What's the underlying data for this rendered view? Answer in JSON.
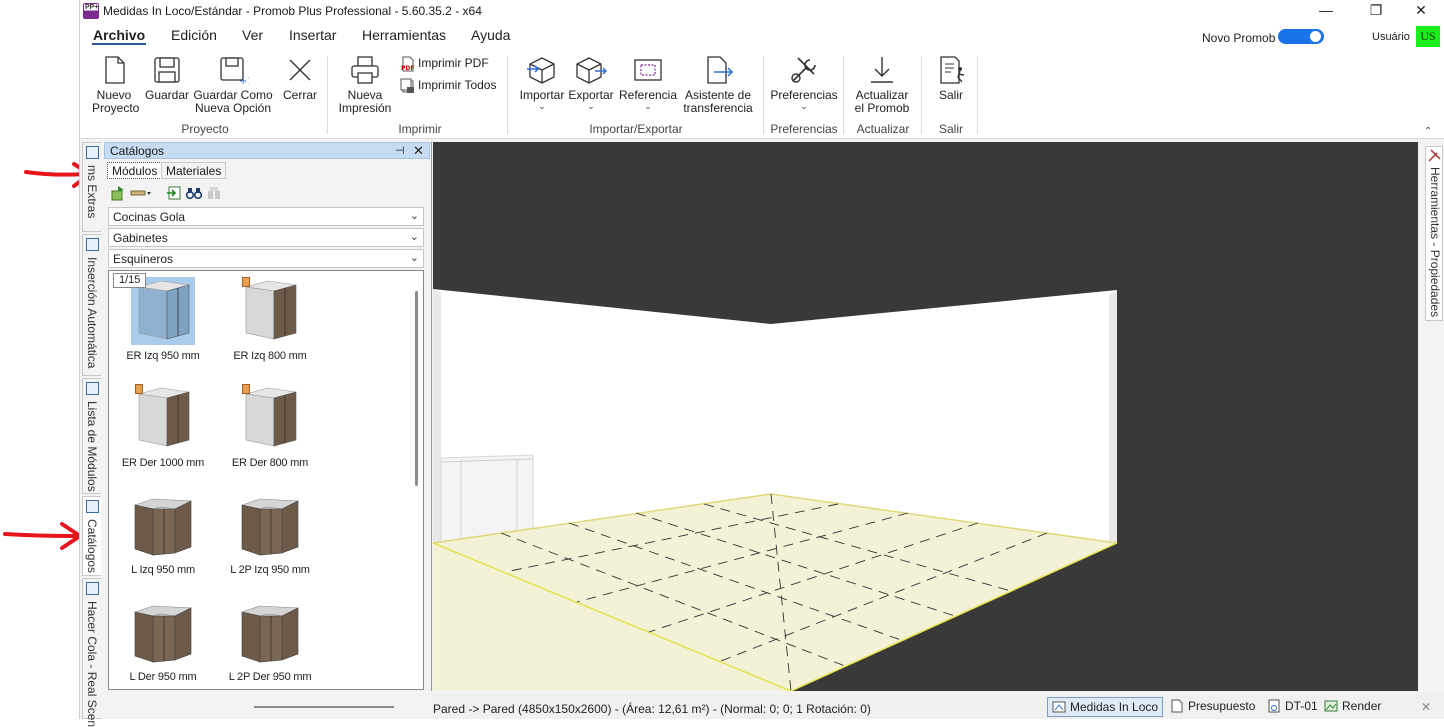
{
  "window": {
    "title": "Medidas In Loco/Estándar - Promob Plus Professional - 5.60.35.2 - x64",
    "logo_text": "PP+",
    "minimize": "—",
    "maximize": "❐",
    "close": "✕"
  },
  "menu": {
    "items": [
      "Archivo",
      "Edición",
      "Ver",
      "Insertar",
      "Herramientas",
      "Ayuda"
    ],
    "novo_promob_label": "Novo Promob",
    "novo_promob_on": true,
    "usuario_label": "Usuário",
    "user_initials": "US",
    "user_badge_color": "#1aee1a"
  },
  "ribbon": {
    "nuevo_proyecto": [
      "Nuevo",
      "Proyecto"
    ],
    "guardar": "Guardar",
    "guardar_como": [
      "Guardar Como",
      "Nueva Opción"
    ],
    "cerrar": "Cerrar",
    "group_proyecto": "Proyecto",
    "nueva_impresion": [
      "Nueva",
      "Impresión"
    ],
    "imprimir_pdf": "Imprimir PDF",
    "imprimir_todos": "Imprimir Todos",
    "group_imprimir": "Imprimir",
    "importar": "Importar",
    "exportar": "Exportar",
    "referencia": "Referencia",
    "asistente": [
      "Asistente de",
      "transferencia"
    ],
    "group_importar_exportar": "Importar/Exportar",
    "preferencias": "Preferencias",
    "group_preferencias": "Preferencias",
    "actualizar": [
      "Actualizar",
      "el Promob"
    ],
    "group_actualizar": "Actualizar",
    "salir": "Salir",
    "group_salir": "Salir",
    "collapse": "⌃"
  },
  "left_tabs": [
    "ms Extras",
    "Inserción Automática",
    "Lista de Módulos",
    "Catálogos",
    "Hacer Cola - Real Scen"
  ],
  "catalog": {
    "title": "Catálogos",
    "pin": "⊣",
    "close": "✕",
    "tabs": [
      "Módulos",
      "Materiales"
    ],
    "combos": [
      "Cocinas Gola",
      "Gabinetes",
      "Esquineros"
    ],
    "page_indicator": "1/15",
    "modules": [
      {
        "label": "ER Izq 950 mm",
        "selected": true,
        "tag": false
      },
      {
        "label": "ER Izq 800 mm",
        "selected": false,
        "tag": true
      },
      {
        "label": "ER Der 1000 mm",
        "selected": false,
        "tag": true
      },
      {
        "label": "ER Der 800 mm",
        "selected": false,
        "tag": true
      },
      {
        "label": "L Izq 950 mm",
        "selected": false,
        "tag": false
      },
      {
        "label": "L 2P Izq 950 mm",
        "selected": false,
        "tag": false
      },
      {
        "label": "L Der 950 mm",
        "selected": false,
        "tag": false
      },
      {
        "label": "L 2P Der 950 mm",
        "selected": false,
        "tag": false
      }
    ]
  },
  "right_tab": "Herramientas - Propiedades",
  "status": {
    "text": "Pared -> Pared (4850x150x2600) - (Área: 12,61 m²) - (Normal: 0; 0; 1 Rotación: 0)",
    "buttons": [
      "Medidas In Loco",
      "Presupuesto",
      "DT-01",
      "Render"
    ],
    "active_button": "Medidas In Loco",
    "close": "✕"
  },
  "colors": {
    "accent": "#2b579a",
    "viewport_bg": "#393939",
    "floor": "#f4f2d6",
    "wall": "#ffffff",
    "arrow": "#e8141c"
  }
}
